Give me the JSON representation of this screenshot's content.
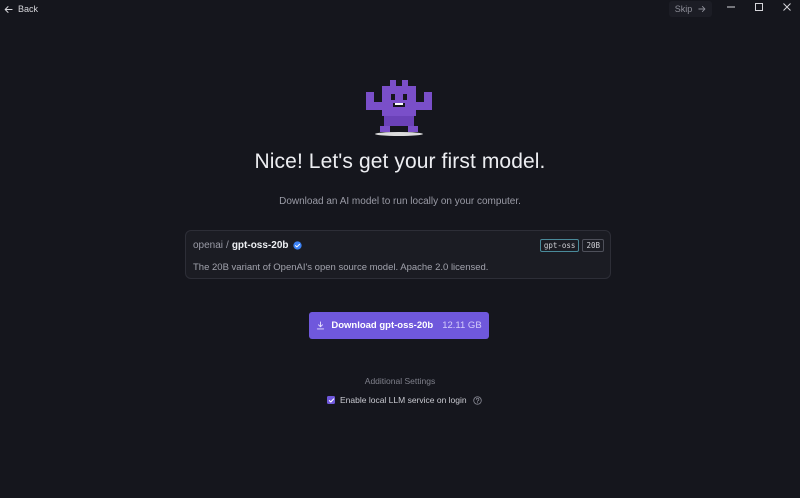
{
  "titlebar": {
    "back_label": "Back",
    "skip_label": "Skip"
  },
  "main": {
    "headline": "Nice! Let's get your first model.",
    "subtitle": "Download an AI model to run locally on your computer."
  },
  "model_card": {
    "org": "openai",
    "separator": "/",
    "repo": "gpt-oss-20b",
    "tags": [
      "gpt-oss",
      "20B"
    ],
    "description": "The 20B variant of OpenAI's open source model. Apache 2.0 licensed."
  },
  "download": {
    "label": "Download gpt-oss-20b",
    "size": "12.11 GB"
  },
  "settings": {
    "heading": "Additional Settings",
    "enable_local_llm_label": "Enable local LLM service on login",
    "enable_local_llm_checked": true
  },
  "colors": {
    "background": "#15161d",
    "accent": "#6f58dc",
    "mascot": "#7a4fc9",
    "verified": "#3b82f6"
  },
  "icons": {
    "back": "arrow-left-icon",
    "skip": "arrow-right-icon",
    "minimize": "minimize-icon",
    "maximize": "maximize-icon",
    "close": "close-icon",
    "verified": "verified-badge-icon",
    "download": "download-icon",
    "help": "help-circle-icon",
    "checkbox": "checkmark-icon"
  }
}
